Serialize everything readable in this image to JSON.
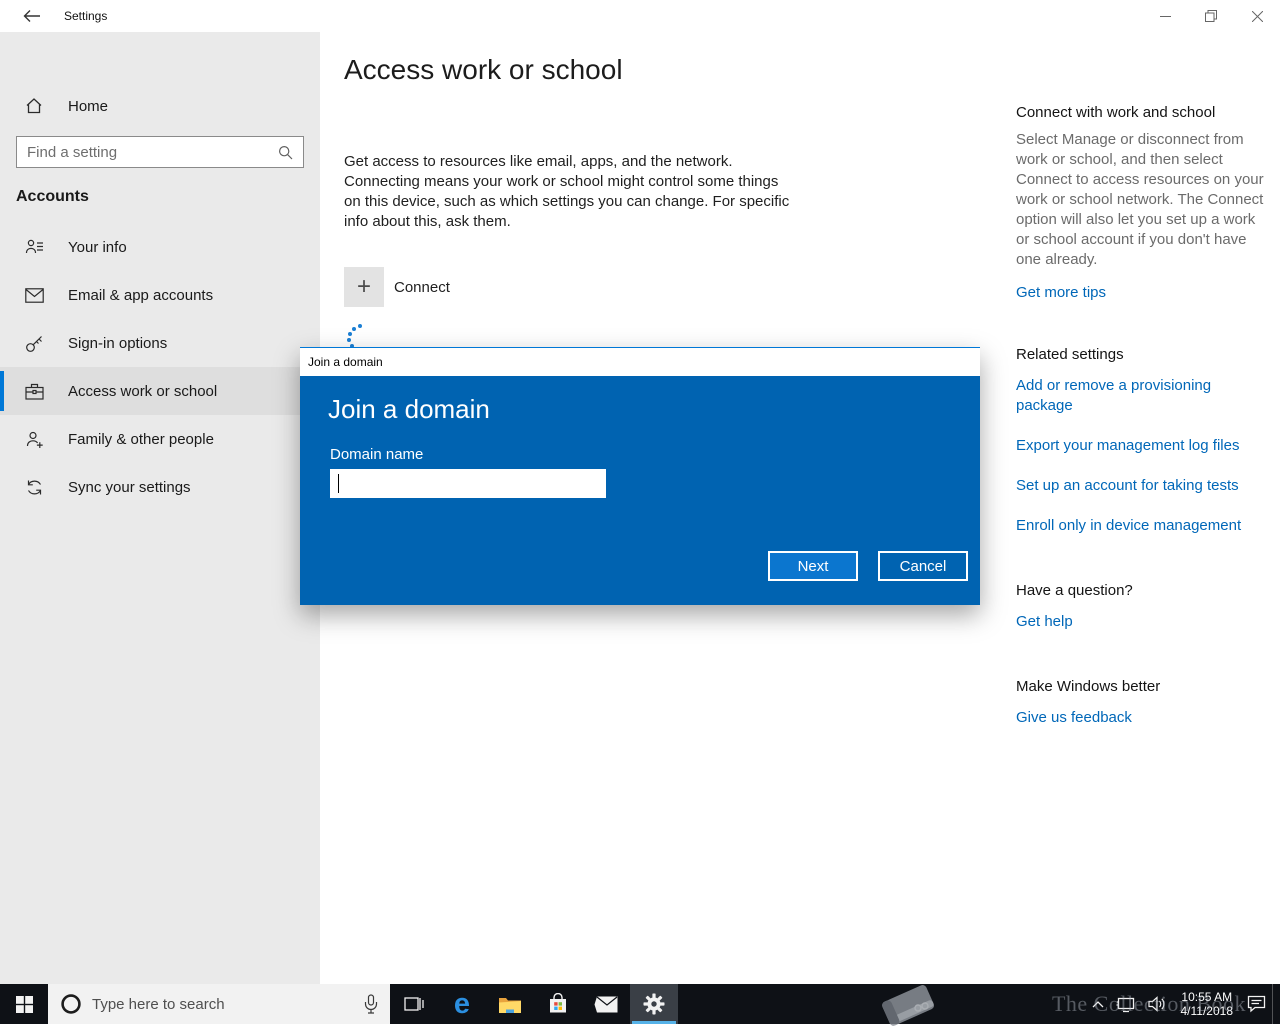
{
  "titlebar": {
    "title": "Settings",
    "minimize": "minimize",
    "maximize": "restore",
    "close": "close"
  },
  "sidebar": {
    "home_label": "Home",
    "search_placeholder": "Find a setting",
    "section_label": "Accounts",
    "items": [
      {
        "label": "Your info",
        "icon": "person-id-icon"
      },
      {
        "label": "Email & app accounts",
        "icon": "envelope-icon"
      },
      {
        "label": "Sign-in options",
        "icon": "key-icon"
      },
      {
        "label": "Access work or school",
        "icon": "briefcase-icon",
        "selected": true
      },
      {
        "label": "Family & other people",
        "icon": "person-add-icon"
      },
      {
        "label": "Sync your settings",
        "icon": "sync-icon"
      }
    ]
  },
  "main": {
    "title": "Access work or school",
    "description": "Get access to resources like email, apps, and the network. Connecting means your work or school might control some things on this device, such as which settings you can change. For specific info about this, ask them.",
    "connect_label": "Connect",
    "connect_plus": "+"
  },
  "dialog": {
    "window_title": "Join a domain",
    "heading": "Join a domain",
    "field_label": "Domain name",
    "input_value": "",
    "next_label": "Next",
    "cancel_label": "Cancel"
  },
  "right_panel": {
    "help_heading": "Connect with work and school",
    "help_text": "Select Manage or disconnect from work or school, and then select Connect to access resources on your work or school network. The Connect option will also let you set up a work or school account if you don't have one already.",
    "help_link": "Get more tips",
    "related_heading": "Related settings",
    "related_links": [
      "Add or remove a provisioning package",
      "Export your management log files",
      "Set up an account for taking tests",
      "Enroll only in device management"
    ],
    "question_heading": "Have a question?",
    "question_link": "Get help",
    "feedback_heading": "Make Windows better",
    "feedback_link": "Give us feedback"
  },
  "taskbar": {
    "search_placeholder": "Type here to search",
    "time": "10:55 AM",
    "date": "4/11/2018",
    "watermark": "The Collection Book"
  },
  "colors": {
    "accent": "#0078d7",
    "dialog_background": "#0063b1",
    "dialog_button": "#0b76cf",
    "link": "#0067b8",
    "sidebar_background": "#eaeaea",
    "taskbar_background": "#0e1116",
    "taskbar_active_underline": "#56b2e8"
  }
}
